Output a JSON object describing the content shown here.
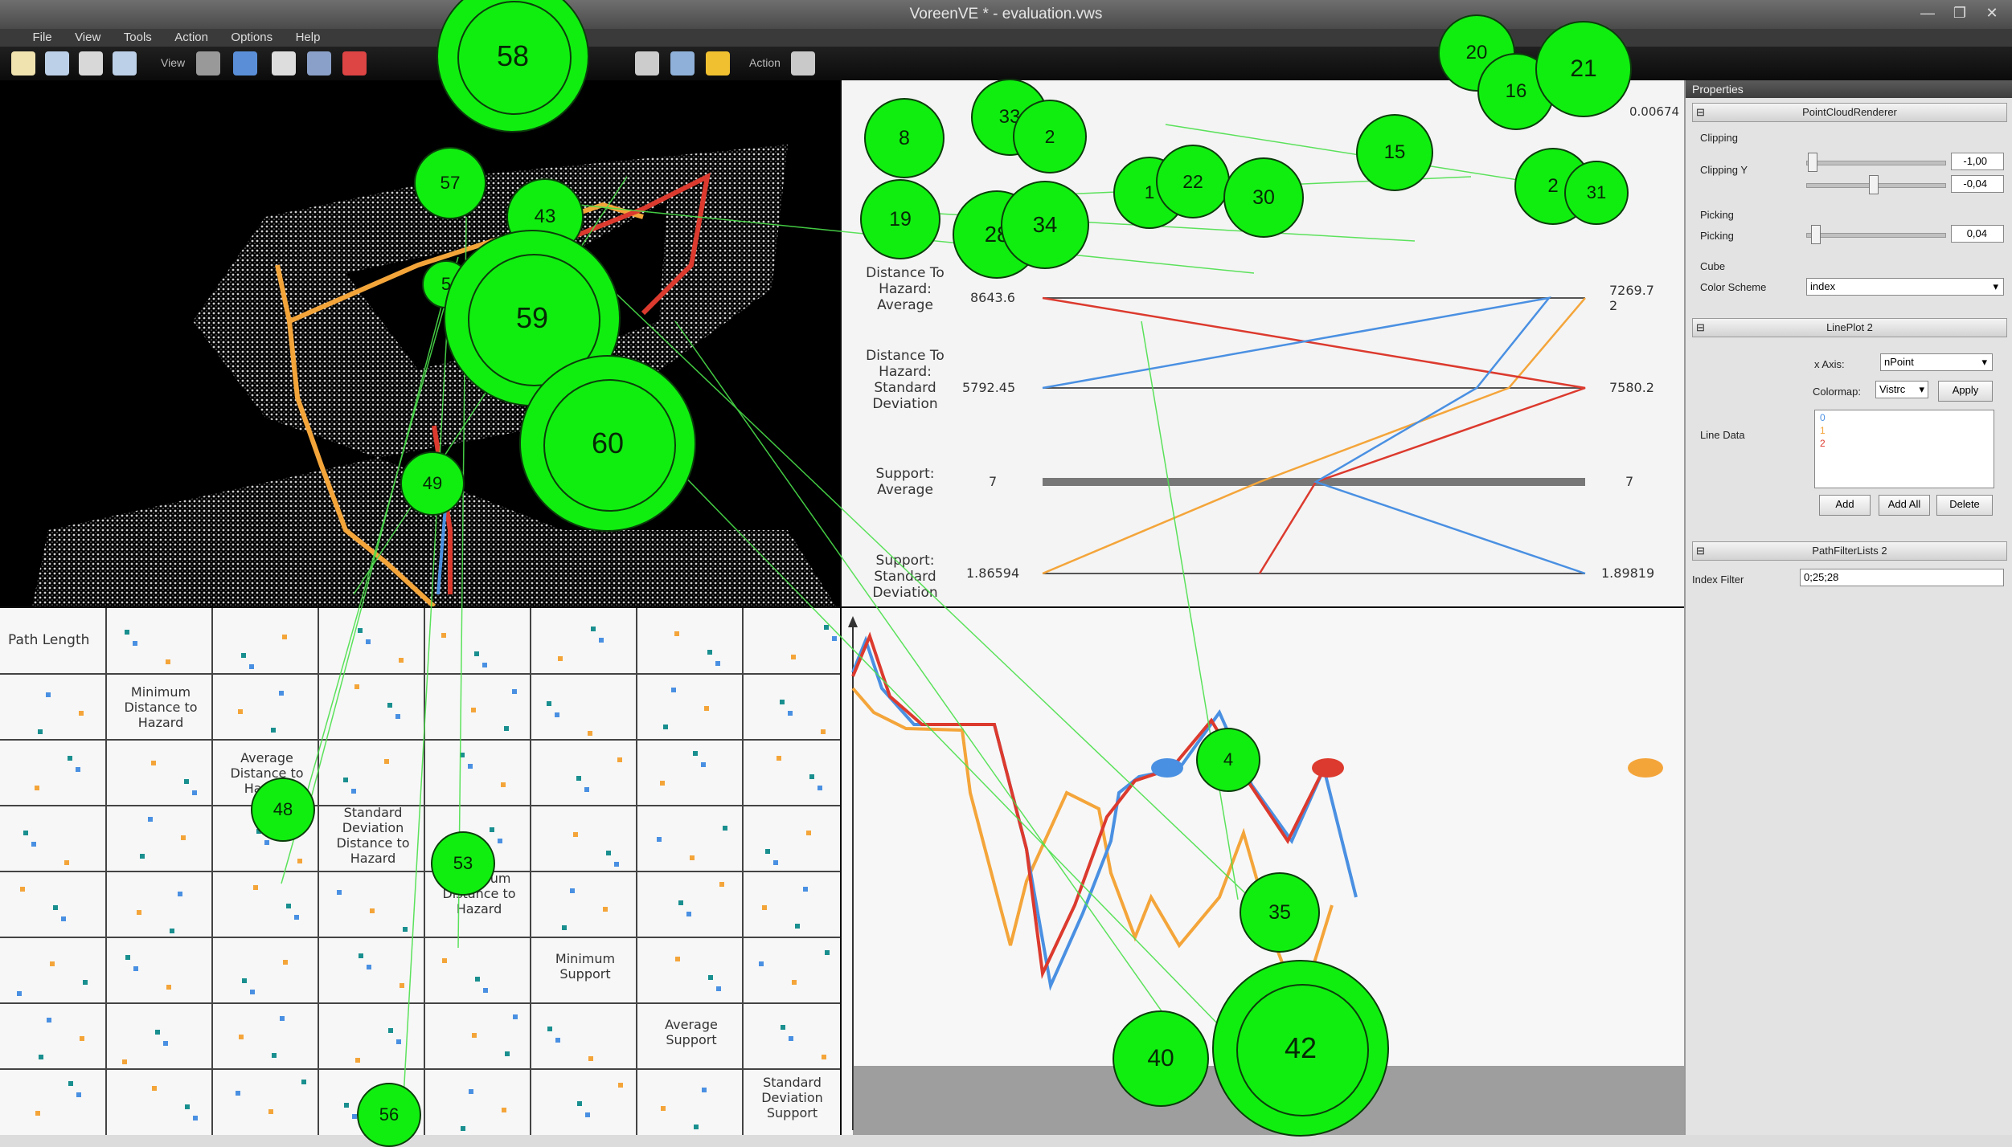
{
  "window": {
    "title": "VoreenVE * - evaluation.vws"
  },
  "menu": [
    "File",
    "View",
    "Tools",
    "Action",
    "Options",
    "Help"
  ],
  "toolbar": {
    "view_label": "View",
    "action_label": "Action"
  },
  "pcp": {
    "axes": [
      {
        "label": "Distance To Hazard: Average",
        "min": "8643.6",
        "max": "7269.72"
      },
      {
        "label": "Distance To Hazard: Standard Deviation",
        "min": "5792.45",
        "max": "7580.2"
      },
      {
        "label": "Support: Average",
        "min": "7",
        "max": "7"
      },
      {
        "label": "Support: Standard Deviation",
        "min": "1.86594",
        "max": "1.89819"
      }
    ],
    "partial_max": "0.00674"
  },
  "spm": {
    "labels": [
      "Path Length",
      "Minimum Distance to Hazard",
      "Average Distance to Hazard",
      "Standard Deviation Distance to Hazard",
      "Maximum Distance to Hazard",
      "Minimum Support",
      "Average Support",
      "Standard Deviation Support"
    ]
  },
  "properties": {
    "panel_title": "Properties",
    "sections": [
      "PointCloudRenderer",
      "LinePlot 2",
      "PathFilterLists 2"
    ],
    "clipping_group": "Clipping",
    "clipping_y_label": "Clipping Y",
    "clip_min": "-1,00",
    "clip_max": "-0,04",
    "picking_group": "Picking",
    "picking_label": "Picking",
    "picking_value": "0,04",
    "cube_group": "Cube",
    "color_scheme_label": "Color Scheme",
    "color_scheme_value": "index",
    "x_axis_label": "x Axis:",
    "x_axis_value": "nPoint",
    "colormap_label": "Colormap:",
    "colormap_value": "Vistrc",
    "apply_label": "Apply",
    "line_data_label": "Line Data",
    "line_items": [
      "0",
      "1",
      "2"
    ],
    "add_label": "Add",
    "add_all_label": "Add All",
    "delete_label": "Delete",
    "index_filter_label": "Index Filter",
    "index_filter_value": "0;25;28"
  },
  "overlay": {
    "markers": [
      {
        "id": "8"
      },
      {
        "id": "33"
      },
      {
        "id": "2"
      },
      {
        "id": "19"
      },
      {
        "id": "28"
      },
      {
        "id": "34"
      },
      {
        "id": "1"
      },
      {
        "id": "22"
      },
      {
        "id": "30"
      },
      {
        "id": "15"
      },
      {
        "id": "20"
      },
      {
        "id": "16"
      },
      {
        "id": "21"
      },
      {
        "id": "2"
      },
      {
        "id": "31"
      },
      {
        "id": "58"
      },
      {
        "id": "57"
      },
      {
        "id": "43"
      },
      {
        "id": "5"
      },
      {
        "id": "59"
      },
      {
        "id": "60"
      },
      {
        "id": "49"
      },
      {
        "id": "48"
      },
      {
        "id": "53"
      },
      {
        "id": "56"
      },
      {
        "id": "4"
      },
      {
        "id": "35"
      },
      {
        "id": "40"
      },
      {
        "id": "4"
      },
      {
        "id": "42"
      }
    ]
  },
  "colors": {
    "blue": "#4a90e2",
    "orange": "#f4a53a",
    "red": "#dc3a2e",
    "marker": "#10ee10"
  }
}
